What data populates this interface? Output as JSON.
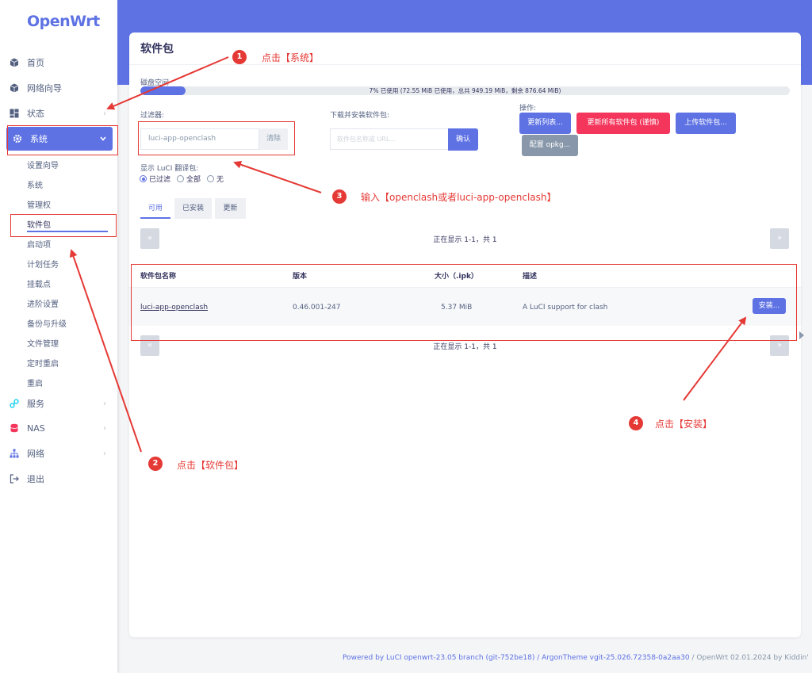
{
  "brand": "OpenWrt",
  "sidebar": {
    "items": [
      {
        "label": "首页",
        "icon": "cube-icon"
      },
      {
        "label": "网络向导",
        "icon": "cube-icon"
      },
      {
        "label": "状态",
        "icon": "dashboard-icon"
      },
      {
        "label": "系统",
        "icon": "gear-icon"
      },
      {
        "label": "服务",
        "icon": "link-icon"
      },
      {
        "label": "NAS",
        "icon": "database-icon"
      },
      {
        "label": "网络",
        "icon": "sitemap-icon"
      },
      {
        "label": "退出",
        "icon": "logout-icon"
      }
    ],
    "system_sub": [
      "设置向导",
      "系统",
      "管理权",
      "软件包",
      "启动项",
      "计划任务",
      "挂载点",
      "进阶设置",
      "备份与升级",
      "文件管理",
      "定时重启",
      "重启"
    ]
  },
  "page": {
    "title": "软件包",
    "disk_label": "磁盘空间",
    "disk_usage_text": "7% 已使用 (72.55 MiB 已使用，总共 949.19 MiB，剩余 876.64 MiB)",
    "disk_percent": 7,
    "filter_label": "过滤器:",
    "filter_value": "luci-app-openclash",
    "filter_clear": "清除",
    "download_label": "下载并安装软件包:",
    "download_placeholder": "软件包名称或 URL…",
    "download_ok": "确认",
    "actions_label": "操作:",
    "btn_update_lists": "更新列表...",
    "btn_upgrade_all": "更新所有软件包 (谨慎)",
    "btn_upload": "上传软件包...",
    "btn_config": "配置 opkg...",
    "translation_label": "显示 LuCI 翻译包:",
    "radio_filtered": "已过滤",
    "radio_all": "全部",
    "radio_none": "无",
    "tabs": [
      "可用",
      "已安装",
      "更新"
    ],
    "pager_prev": "«",
    "pager_next": "»",
    "pager_text": "正在显示 1-1，共 1",
    "table": {
      "headers": [
        "软件包名称",
        "版本",
        "大小（.ipk）",
        "描述"
      ],
      "rows": [
        {
          "name": "luci-app-openclash",
          "version": "0.46.001-247",
          "size": "5.37 MiB",
          "desc": "A LuCI support for clash",
          "action": "安装..."
        }
      ]
    }
  },
  "footer": {
    "powered": "Powered by LuCI openwrt-23.05 branch (git-752be18) / ArgonTheme vgit-25.026.72358-0a2aa30",
    "build": "/ OpenWrt 02.01.2024 by Kiddin'"
  },
  "annotations": [
    {
      "num": "1",
      "text": "点击【系统】"
    },
    {
      "num": "2",
      "text": "点击【软件包】"
    },
    {
      "num": "3",
      "text": "输入【openclash或者luci-app-openclash】"
    },
    {
      "num": "4",
      "text": "点击【安装】"
    }
  ],
  "colors": {
    "accent": "#5e72e4",
    "danger": "#f5365c",
    "annotation": "#e53935"
  }
}
